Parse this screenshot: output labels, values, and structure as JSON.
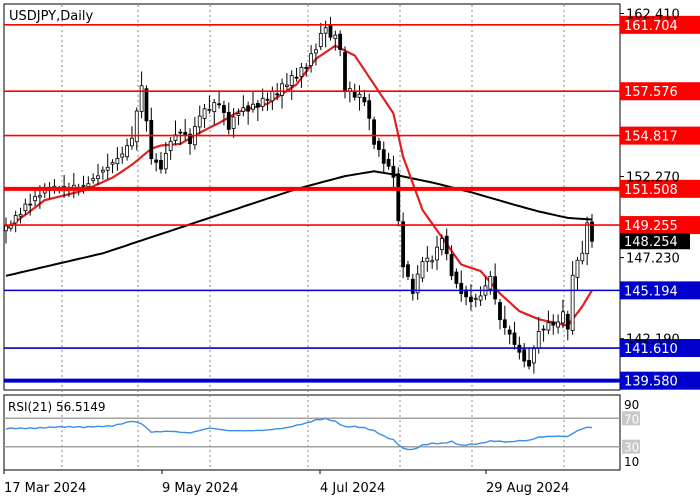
{
  "symbol_label": "USDJPY,Daily",
  "rsi_label": "RSI(21) 56.5149",
  "colors": {
    "red": "#ff0000",
    "blue": "#0000cc",
    "sma_red": "#e02020",
    "sma_black": "#000000",
    "rsi_line": "#3a8ee6",
    "candle_up": "#ffffff",
    "candle_down": "#000000",
    "grid": "#888888"
  },
  "chart_data": [
    {
      "type": "candlestick",
      "title": "USDJPY,Daily",
      "y_tick_labels": [
        "162.410",
        "152.270",
        "147.230",
        "142.190"
      ],
      "ylim": [
        139.0,
        163.0
      ],
      "x_tick_labels": [
        "17 Mar 2024",
        "9 May 2024",
        "4 Jul 2024",
        "29 Aug 2024"
      ],
      "current_price_label": "148.254",
      "levels": [
        {
          "value": 161.704,
          "label": "161.704",
          "color": "red",
          "weight": "thin"
        },
        {
          "value": 157.576,
          "label": "157.576",
          "color": "red",
          "weight": "thin"
        },
        {
          "value": 154.817,
          "label": "154.817",
          "color": "red",
          "weight": "thin"
        },
        {
          "value": 151.508,
          "label": "151.508",
          "color": "red",
          "weight": "thick"
        },
        {
          "value": 149.255,
          "label": "149.255",
          "color": "red",
          "weight": "thin"
        },
        {
          "value": 145.194,
          "label": "145.194",
          "color": "blue",
          "weight": "thin"
        },
        {
          "value": 141.61,
          "label": "141.610",
          "color": "blue",
          "weight": "thin"
        },
        {
          "value": 139.58,
          "label": "139.580",
          "color": "blue",
          "weight": "thick"
        }
      ],
      "close_anchors": [
        [
          0,
          149.0
        ],
        [
          4,
          150.6
        ],
        [
          8,
          151.5
        ],
        [
          12,
          151.4
        ],
        [
          16,
          151.7
        ],
        [
          20,
          152.8
        ],
        [
          24,
          153.6
        ],
        [
          26,
          154.5
        ],
        [
          28,
          157.8
        ],
        [
          30,
          153.4
        ],
        [
          32,
          152.9
        ],
        [
          34,
          154.7
        ],
        [
          36,
          155.2
        ],
        [
          38,
          154.4
        ],
        [
          40,
          156.0
        ],
        [
          44,
          156.8
        ],
        [
          46,
          155.4
        ],
        [
          48,
          156.5
        ],
        [
          52,
          156.8
        ],
        [
          56,
          157.4
        ],
        [
          60,
          158.6
        ],
        [
          62,
          159.3
        ],
        [
          64,
          160.5
        ],
        [
          66,
          161.8
        ],
        [
          67,
          160.8
        ],
        [
          68,
          161.2
        ],
        [
          69,
          159.9
        ],
        [
          70,
          157.6
        ],
        [
          72,
          157.2
        ],
        [
          74,
          157.0
        ],
        [
          76,
          154.5
        ],
        [
          78,
          153.4
        ],
        [
          80,
          152.5
        ],
        [
          81,
          149.5
        ],
        [
          82,
          146.8
        ],
        [
          84,
          145.0
        ],
        [
          86,
          146.9
        ],
        [
          88,
          147.0
        ],
        [
          90,
          148.5
        ],
        [
          91,
          147.5
        ],
        [
          92,
          146.3
        ],
        [
          94,
          145.2
        ],
        [
          96,
          144.6
        ],
        [
          98,
          144.8
        ],
        [
          100,
          145.9
        ],
        [
          101,
          144.5
        ],
        [
          102,
          143.2
        ],
        [
          104,
          142.4
        ],
        [
          106,
          141.4
        ],
        [
          108,
          140.6
        ],
        [
          109,
          141.8
        ],
        [
          110,
          142.7
        ],
        [
          112,
          143.1
        ],
        [
          114,
          143.0
        ],
        [
          115,
          143.8
        ],
        [
          116,
          142.5
        ],
        [
          117,
          146.1
        ],
        [
          119,
          147.6
        ],
        [
          120,
          149.3
        ],
        [
          121,
          148.25
        ]
      ],
      "sma_short_anchors": [
        [
          0,
          149.0
        ],
        [
          8,
          150.8
        ],
        [
          16,
          151.4
        ],
        [
          22,
          152.2
        ],
        [
          26,
          153.0
        ],
        [
          30,
          154.0
        ],
        [
          32,
          154.2
        ],
        [
          36,
          154.3
        ],
        [
          40,
          155.0
        ],
        [
          44,
          155.6
        ],
        [
          48,
          156.3
        ],
        [
          54,
          156.8
        ],
        [
          60,
          158.0
        ],
        [
          64,
          159.6
        ],
        [
          68,
          160.4
        ],
        [
          72,
          159.8
        ],
        [
          76,
          158.0
        ],
        [
          80,
          156.2
        ],
        [
          82,
          153.5
        ],
        [
          86,
          150.2
        ],
        [
          90,
          148.5
        ],
        [
          94,
          146.8
        ],
        [
          98,
          146.4
        ],
        [
          102,
          145.0
        ],
        [
          106,
          143.9
        ],
        [
          110,
          143.4
        ],
        [
          116,
          143.0
        ],
        [
          119,
          144.2
        ],
        [
          121,
          145.2
        ]
      ],
      "sma_long_anchors": [
        [
          0,
          146.1
        ],
        [
          20,
          147.5
        ],
        [
          40,
          149.5
        ],
        [
          60,
          151.5
        ],
        [
          70,
          152.3
        ],
        [
          76,
          152.6
        ],
        [
          80,
          152.4
        ],
        [
          88,
          151.9
        ],
        [
          96,
          151.3
        ],
        [
          104,
          150.6
        ],
        [
          110,
          150.1
        ],
        [
          116,
          149.7
        ],
        [
          121,
          149.6
        ]
      ]
    },
    {
      "type": "line",
      "title": "RSI(21) 56.5149",
      "series_value": 56.5149,
      "ylim": [
        0,
        100
      ],
      "y_tick_labels": [
        "90",
        "70",
        "30",
        "10"
      ],
      "reference_levels": [
        70,
        30
      ],
      "rsi_anchors": [
        [
          0,
          55
        ],
        [
          4,
          56
        ],
        [
          10,
          58
        ],
        [
          16,
          57
        ],
        [
          22,
          60
        ],
        [
          26,
          66
        ],
        [
          28,
          62
        ],
        [
          30,
          50
        ],
        [
          34,
          52
        ],
        [
          38,
          50
        ],
        [
          42,
          56
        ],
        [
          46,
          52
        ],
        [
          50,
          53
        ],
        [
          54,
          54
        ],
        [
          58,
          56
        ],
        [
          62,
          63
        ],
        [
          64,
          68
        ],
        [
          66,
          70
        ],
        [
          68,
          66
        ],
        [
          70,
          58
        ],
        [
          72,
          58
        ],
        [
          74,
          56
        ],
        [
          76,
          52
        ],
        [
          78,
          45
        ],
        [
          80,
          40
        ],
        [
          82,
          28
        ],
        [
          84,
          26
        ],
        [
          86,
          32
        ],
        [
          88,
          34
        ],
        [
          90,
          34
        ],
        [
          92,
          37
        ],
        [
          94,
          32
        ],
        [
          96,
          34
        ],
        [
          98,
          35
        ],
        [
          100,
          38
        ],
        [
          102,
          37
        ],
        [
          104,
          36
        ],
        [
          106,
          38
        ],
        [
          108,
          39
        ],
        [
          110,
          44
        ],
        [
          112,
          45
        ],
        [
          114,
          45
        ],
        [
          116,
          44
        ],
        [
          118,
          52
        ],
        [
          120,
          57
        ],
        [
          121,
          56.5
        ]
      ]
    }
  ]
}
